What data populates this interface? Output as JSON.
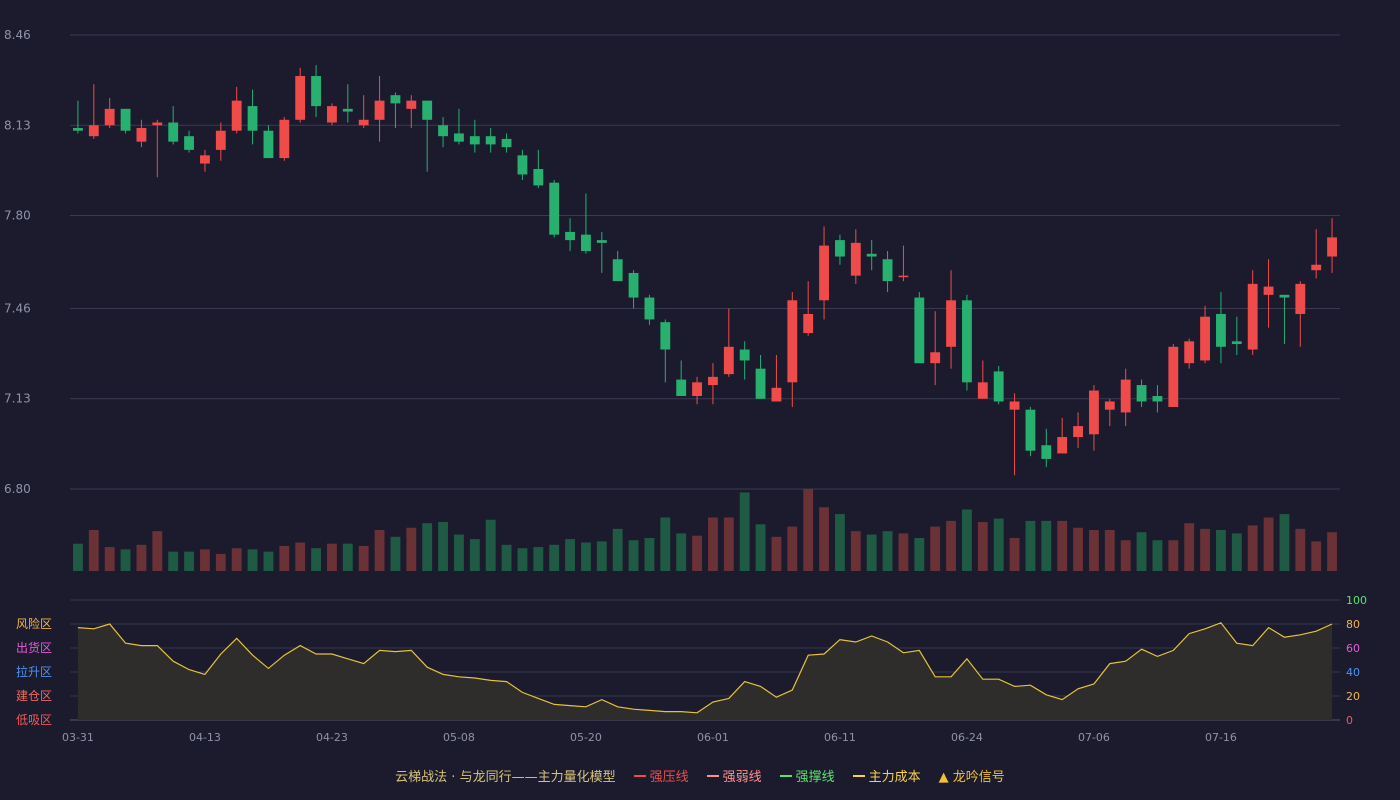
{
  "footer": {
    "brand": "云梯战法 · 与龙同行",
    "model_label": "——主力量化模型",
    "legend": [
      {
        "label": "强压线",
        "color": "#ef4b4b",
        "style": "solid"
      },
      {
        "label": "强弱线",
        "color": "#ff8f8f",
        "style": "dashed"
      },
      {
        "label": "强撑线",
        "color": "#58e36b",
        "style": "solid"
      },
      {
        "label": "主力成本",
        "color": "#f6d24a",
        "style": "dashed"
      },
      {
        "label": "龙吟信号",
        "color": "#f1c232",
        "style": "triangle",
        "icon": "▲"
      }
    ]
  },
  "chart_data": [
    {
      "type": "candlestick",
      "ylim": [
        6.8,
        8.46
      ],
      "ytick_labels": [
        "8.46",
        "8.13",
        "7.80",
        "7.46",
        "7.13",
        "6.80"
      ],
      "xtick_labels": [
        "03-31",
        "04-13",
        "04-23",
        "05-08",
        "05-20",
        "06-01",
        "06-11",
        "06-24",
        "07-06",
        "07-16"
      ],
      "xtick_index": [
        0,
        8,
        16,
        24,
        32,
        40,
        48,
        56,
        64,
        72
      ],
      "up_color": "#ef4b4b",
      "down_color": "#27b070",
      "ohlc": [
        [
          8.12,
          8.11,
          8.22,
          8.1
        ],
        [
          8.09,
          8.13,
          8.28,
          8.08
        ],
        [
          8.13,
          8.19,
          8.23,
          8.12
        ],
        [
          8.19,
          8.11,
          8.19,
          8.1
        ],
        [
          8.07,
          8.12,
          8.15,
          8.05
        ],
        [
          8.13,
          8.14,
          8.15,
          7.94
        ],
        [
          8.14,
          8.07,
          8.2,
          8.06
        ],
        [
          8.09,
          8.04,
          8.11,
          8.03
        ],
        [
          7.99,
          8.02,
          8.04,
          7.96
        ],
        [
          8.04,
          8.11,
          8.14,
          8.0
        ],
        [
          8.11,
          8.22,
          8.27,
          8.1
        ],
        [
          8.2,
          8.11,
          8.26,
          8.06
        ],
        [
          8.11,
          8.01,
          8.13,
          8.01
        ],
        [
          8.01,
          8.15,
          8.16,
          8.0
        ],
        [
          8.15,
          8.31,
          8.34,
          8.14
        ],
        [
          8.31,
          8.2,
          8.35,
          8.16
        ],
        [
          8.14,
          8.2,
          8.21,
          8.13
        ],
        [
          8.19,
          8.18,
          8.28,
          8.14
        ],
        [
          8.13,
          8.15,
          8.24,
          8.12
        ],
        [
          8.15,
          8.22,
          8.31,
          8.07
        ],
        [
          8.24,
          8.21,
          8.25,
          8.12
        ],
        [
          8.19,
          8.22,
          8.24,
          8.12
        ],
        [
          8.22,
          8.15,
          8.22,
          7.96
        ],
        [
          8.13,
          8.09,
          8.16,
          8.05
        ],
        [
          8.1,
          8.07,
          8.19,
          8.06
        ],
        [
          8.09,
          8.06,
          8.15,
          8.03
        ],
        [
          8.09,
          8.06,
          8.12,
          8.03
        ],
        [
          8.08,
          8.05,
          8.1,
          8.03
        ],
        [
          8.02,
          7.95,
          8.04,
          7.93
        ],
        [
          7.97,
          7.91,
          8.04,
          7.9
        ],
        [
          7.92,
          7.73,
          7.93,
          7.72
        ],
        [
          7.74,
          7.71,
          7.79,
          7.67
        ],
        [
          7.73,
          7.67,
          7.88,
          7.66
        ],
        [
          7.71,
          7.7,
          7.74,
          7.59
        ],
        [
          7.64,
          7.56,
          7.67,
          7.56
        ],
        [
          7.59,
          7.5,
          7.6,
          7.46
        ],
        [
          7.5,
          7.42,
          7.51,
          7.4
        ],
        [
          7.41,
          7.31,
          7.42,
          7.19
        ],
        [
          7.2,
          7.14,
          7.27,
          7.14
        ],
        [
          7.14,
          7.19,
          7.21,
          7.11
        ],
        [
          7.18,
          7.21,
          7.26,
          7.11
        ],
        [
          7.22,
          7.32,
          7.46,
          7.21
        ],
        [
          7.31,
          7.27,
          7.34,
          7.2
        ],
        [
          7.24,
          7.13,
          7.29,
          7.13
        ],
        [
          7.12,
          7.17,
          7.29,
          7.12
        ],
        [
          7.19,
          7.49,
          7.52,
          7.1
        ],
        [
          7.37,
          7.44,
          7.56,
          7.36
        ],
        [
          7.49,
          7.69,
          7.76,
          7.42
        ],
        [
          7.71,
          7.65,
          7.73,
          7.62
        ],
        [
          7.58,
          7.7,
          7.75,
          7.55
        ],
        [
          7.66,
          7.65,
          7.71,
          7.6
        ],
        [
          7.64,
          7.56,
          7.67,
          7.52
        ],
        [
          7.58,
          7.58,
          7.69,
          7.56
        ],
        [
          7.5,
          7.26,
          7.52,
          7.26
        ],
        [
          7.26,
          7.3,
          7.45,
          7.18
        ],
        [
          7.32,
          7.49,
          7.6,
          7.24
        ],
        [
          7.49,
          7.19,
          7.51,
          7.16
        ],
        [
          7.13,
          7.19,
          7.27,
          7.13
        ],
        [
          7.23,
          7.12,
          7.25,
          7.11
        ],
        [
          7.09,
          7.12,
          7.15,
          6.85
        ],
        [
          7.09,
          6.94,
          7.1,
          6.92
        ],
        [
          6.96,
          6.91,
          7.02,
          6.88
        ],
        [
          6.93,
          6.99,
          7.06,
          6.93
        ],
        [
          6.99,
          7.03,
          7.08,
          6.95
        ],
        [
          7.0,
          7.16,
          7.18,
          6.94
        ],
        [
          7.09,
          7.12,
          7.13,
          7.03
        ],
        [
          7.08,
          7.2,
          7.24,
          7.03
        ],
        [
          7.18,
          7.12,
          7.2,
          7.1
        ],
        [
          7.14,
          7.12,
          7.18,
          7.08
        ],
        [
          7.1,
          7.32,
          7.33,
          7.1
        ],
        [
          7.26,
          7.34,
          7.35,
          7.24
        ],
        [
          7.27,
          7.43,
          7.47,
          7.26
        ],
        [
          7.44,
          7.32,
          7.52,
          7.26
        ],
        [
          7.34,
          7.33,
          7.43,
          7.29
        ],
        [
          7.31,
          7.55,
          7.6,
          7.29
        ],
        [
          7.51,
          7.54,
          7.64,
          7.39
        ],
        [
          7.51,
          7.5,
          7.51,
          7.33
        ],
        [
          7.44,
          7.55,
          7.56,
          7.32
        ],
        [
          7.6,
          7.62,
          7.75,
          7.57
        ],
        [
          7.65,
          7.72,
          7.79,
          7.59
        ]
      ],
      "volumes": [
        24,
        36,
        21,
        19,
        23,
        35,
        17,
        17,
        19,
        15,
        20,
        19,
        17,
        22,
        25,
        20,
        24,
        24,
        22,
        36,
        30,
        38,
        42,
        43,
        32,
        28,
        45,
        23,
        20,
        21,
        23,
        28,
        25,
        26,
        37,
        27,
        29,
        47,
        33,
        31,
        47,
        47,
        69,
        41,
        30,
        39,
        72,
        56,
        50,
        35,
        32,
        35,
        33,
        29,
        39,
        44,
        54,
        43,
        46,
        29,
        44,
        44,
        44,
        38,
        36,
        36,
        27,
        34,
        27,
        27,
        42,
        37,
        36,
        33,
        40,
        47,
        50,
        37,
        26,
        34
      ],
      "volume_colors": "match candle direction"
    },
    {
      "type": "area",
      "ylim": [
        0,
        100
      ],
      "yticks_right": [
        "100",
        "80",
        "60",
        "40",
        "20",
        "0"
      ],
      "zone_labels": [
        {
          "label": "风险区",
          "color": "#f3b44a"
        },
        {
          "label": "出货区",
          "color": "#e45ad6"
        },
        {
          "label": "拉升区",
          "color": "#4f92f0"
        },
        {
          "label": "建仓区",
          "color": "#ef6b5f"
        },
        {
          "label": "低吸区",
          "color": "#ef5a5a"
        }
      ],
      "line_color": "#e5c23a",
      "values": [
        77,
        76,
        80,
        64,
        62,
        62,
        49,
        42,
        38,
        55,
        68,
        54,
        43,
        54,
        62,
        55,
        55,
        51,
        47,
        58,
        57,
        58,
        44,
        38,
        36,
        35,
        33,
        32,
        23,
        18,
        13,
        12,
        11,
        17,
        11,
        9,
        8,
        7,
        7,
        6,
        15,
        18,
        32,
        28,
        19,
        25,
        54,
        55,
        67,
        65,
        70,
        65,
        56,
        58,
        36,
        36,
        51,
        34,
        34,
        28,
        29,
        21,
        17,
        26,
        30,
        47,
        49,
        59,
        53,
        58,
        72,
        76,
        81,
        64,
        62,
        77,
        69,
        71,
        74,
        80
      ]
    }
  ]
}
